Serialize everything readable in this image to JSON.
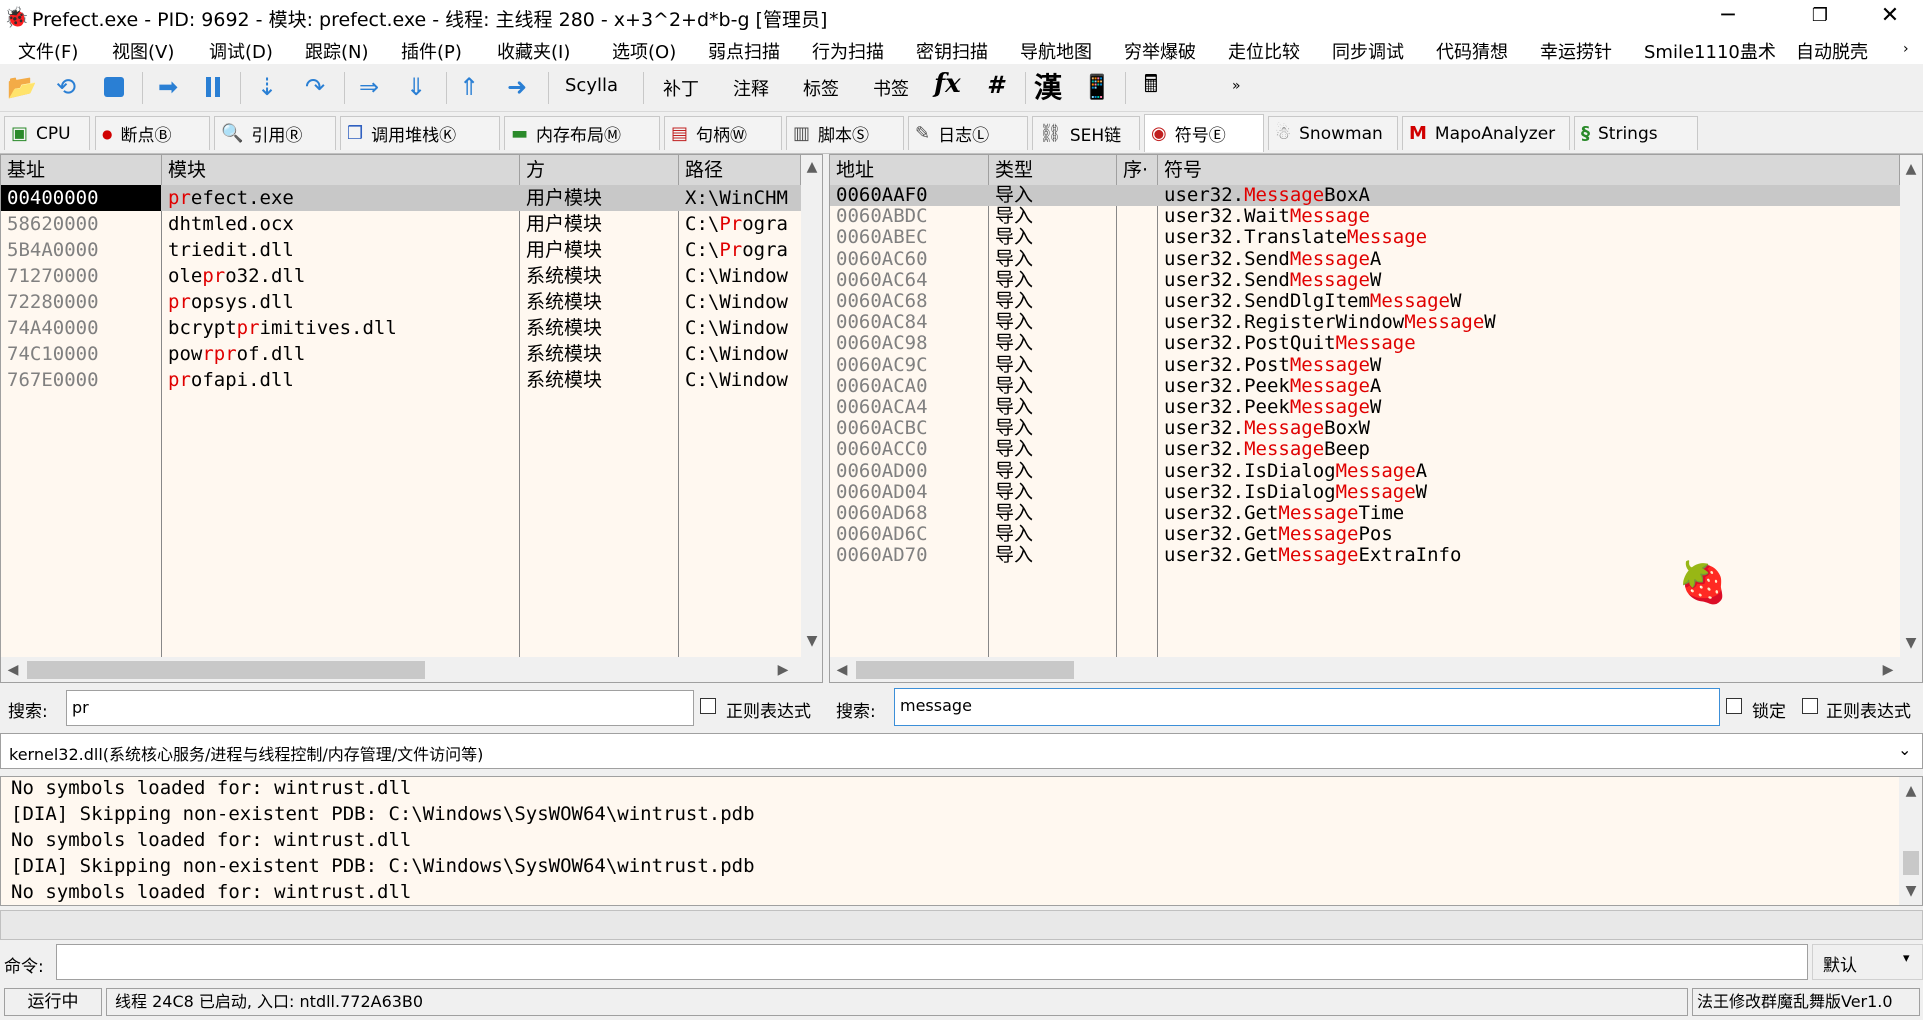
{
  "window": {
    "title": "Prefect.exe - PID: 9692 - 模块: prefect.exe - 线程: 主线程 280 - x+3^2+d*b-g [管理员]",
    "minimize": "─",
    "maximize": "❐",
    "close": "✕"
  },
  "menu": [
    "文件(F)",
    "视图(V)",
    "调试(D)",
    "跟踪(N)",
    "插件(P)",
    "收藏夹(I)",
    "选项(O)",
    "弱点扫描",
    "行为扫描",
    "密钥扫描",
    "导航地图",
    "穷举爆破",
    "走位比较",
    "同步调试",
    "代码猜想",
    "幸运捞针",
    "Smile1110蛊术",
    "自动脱壳"
  ],
  "menu_scroll_icon": "chevron-right-icon",
  "toolbar": {
    "text_buttons": [
      "Scylla",
      "补丁",
      "注释",
      "标签",
      "书签"
    ],
    "fx_label": "fx",
    "hash_label": "#",
    "han_label": "漢",
    "more_label": "»"
  },
  "tabs": [
    {
      "label": "CPU",
      "icon": "cpu-icon"
    },
    {
      "label": "断点Ⓑ",
      "icon": "breakpoint-icon"
    },
    {
      "label": "引用Ⓡ",
      "icon": "magnifier-icon"
    },
    {
      "label": "调用堆栈Ⓚ",
      "icon": "stack-icon"
    },
    {
      "label": "内存布局Ⓜ",
      "icon": "memory-icon"
    },
    {
      "label": "句柄Ⓦ",
      "icon": "handle-icon"
    },
    {
      "label": "脚本Ⓢ",
      "icon": "script-icon"
    },
    {
      "label": "日志Ⓛ",
      "icon": "log-icon"
    },
    {
      "label": "SEH链",
      "icon": "seh-icon"
    },
    {
      "label": "符号Ⓔ",
      "icon": "symbol-icon"
    },
    {
      "label": "Snowman",
      "icon": "snowman-icon"
    },
    {
      "label": "MapoAnalyzer",
      "icon": "mapo-icon"
    },
    {
      "label": "Strings",
      "icon": "strings-icon"
    }
  ],
  "modules": {
    "headers": [
      "基址",
      "模块",
      "方",
      "路径"
    ],
    "rows": [
      {
        "base": "00400000",
        "pre": "",
        "hl": "pr",
        "post": "efect.exe",
        "type": "用户模块",
        "path_pre": "X:\\WinCHM",
        "path_hl": "",
        "path_post": "",
        "selected": true
      },
      {
        "base": "58620000",
        "pre": "dhtmled.ocx",
        "hl": "",
        "post": "",
        "type": "用户模块",
        "path_pre": "C:\\",
        "path_hl": "Pr",
        "path_post": "ogra"
      },
      {
        "base": "5B4A0000",
        "pre": "triedit.dll",
        "hl": "",
        "post": "",
        "type": "用户模块",
        "path_pre": "C:\\",
        "path_hl": "Pr",
        "path_post": "ogra"
      },
      {
        "base": "71270000",
        "pre": "ole",
        "hl": "pr",
        "post": "o32.dll",
        "type": "系统模块",
        "path_pre": "C:\\Window",
        "path_hl": "",
        "path_post": ""
      },
      {
        "base": "72280000",
        "pre": "",
        "hl": "pr",
        "post": "opsys.dll",
        "type": "系统模块",
        "path_pre": "C:\\Window",
        "path_hl": "",
        "path_post": ""
      },
      {
        "base": "74A40000",
        "pre": "bcrypt",
        "hl": "pr",
        "post": "imitives.dll",
        "type": "系统模块",
        "path_pre": "C:\\Window",
        "path_hl": "",
        "path_post": ""
      },
      {
        "base": "74C10000",
        "pre": "pow",
        "hl": "rpr",
        "post": "of.dll",
        "type": "系统模块",
        "path_pre": "C:\\Window",
        "path_hl": "",
        "path_post": ""
      },
      {
        "base": "767E0000",
        "pre": "",
        "hl": "pr",
        "post": "ofapi.dll",
        "type": "系统模块",
        "path_pre": "C:\\Window",
        "path_hl": "",
        "path_post": ""
      }
    ]
  },
  "symbols": {
    "headers": [
      "地址",
      "类型",
      "序·",
      "符号"
    ],
    "rows": [
      {
        "addr": "0060AAF0",
        "type": "导入",
        "pre": "user32.",
        "hl": "Message",
        "post": "BoxA",
        "selected": true
      },
      {
        "addr": "0060ABDC",
        "type": "导入",
        "pre": "user32.Wait",
        "hl": "Message",
        "post": ""
      },
      {
        "addr": "0060ABEC",
        "type": "导入",
        "pre": "user32.Translate",
        "hl": "Message",
        "post": ""
      },
      {
        "addr": "0060AC60",
        "type": "导入",
        "pre": "user32.Send",
        "hl": "Message",
        "post": "A"
      },
      {
        "addr": "0060AC64",
        "type": "导入",
        "pre": "user32.Send",
        "hl": "Message",
        "post": "W"
      },
      {
        "addr": "0060AC68",
        "type": "导入",
        "pre": "user32.SendDlgItem",
        "hl": "Message",
        "post": "W"
      },
      {
        "addr": "0060AC84",
        "type": "导入",
        "pre": "user32.RegisterWindow",
        "hl": "Message",
        "post": "W"
      },
      {
        "addr": "0060AC98",
        "type": "导入",
        "pre": "user32.PostQuit",
        "hl": "Message",
        "post": ""
      },
      {
        "addr": "0060AC9C",
        "type": "导入",
        "pre": "user32.Post",
        "hl": "Message",
        "post": "W"
      },
      {
        "addr": "0060ACA0",
        "type": "导入",
        "pre": "user32.Peek",
        "hl": "Message",
        "post": "A"
      },
      {
        "addr": "0060ACA4",
        "type": "导入",
        "pre": "user32.Peek",
        "hl": "Message",
        "post": "W"
      },
      {
        "addr": "0060ACBC",
        "type": "导入",
        "pre": "user32.",
        "hl": "Message",
        "post": "BoxW"
      },
      {
        "addr": "0060ACC0",
        "type": "导入",
        "pre": "user32.",
        "hl": "Message",
        "post": "Beep"
      },
      {
        "addr": "0060AD00",
        "type": "导入",
        "pre": "user32.IsDialog",
        "hl": "Message",
        "post": "A"
      },
      {
        "addr": "0060AD04",
        "type": "导入",
        "pre": "user32.IsDialog",
        "hl": "Message",
        "post": "W"
      },
      {
        "addr": "0060AD68",
        "type": "导入",
        "pre": "user32.Get",
        "hl": "Message",
        "post": "Time"
      },
      {
        "addr": "0060AD6C",
        "type": "导入",
        "pre": "user32.Get",
        "hl": "Message",
        "post": "Pos"
      },
      {
        "addr": "0060AD70",
        "type": "导入",
        "pre": "user32.Get",
        "hl": "Message",
        "post": "ExtraInfo"
      }
    ]
  },
  "search_left": {
    "label": "搜索:",
    "value": "pr",
    "regex_label": "正则表达式"
  },
  "search_right": {
    "label": "搜索:",
    "value": "message",
    "lock_label": "锁定",
    "regex_label": "正则表达式"
  },
  "module_combo": {
    "value": "kernel32.dll(系统核心服务/进程与线程控制/内存管理/文件访问等)"
  },
  "log_lines": [
    "No symbols loaded for: wintrust.dll",
    "[DIA] Skipping non-existent PDB: C:\\Windows\\SysWOW64\\wintrust.pdb",
    "No symbols loaded for: wintrust.dll",
    "[DIA] Skipping non-existent PDB: C:\\Windows\\SysWOW64\\wintrust.pdb",
    "No symbols loaded for: wintrust.dll"
  ],
  "command": {
    "label": "命令:",
    "value": "",
    "mode": "默认"
  },
  "status": {
    "state": "运行中",
    "message": "线程 24C8 已启动, 入口: ntdll.772A63B0",
    "version": "法王修改群魔乱舞版Ver1.0"
  },
  "colors": {
    "highlight": "#e00000",
    "selection": "#c8c8c8",
    "panel_bg": "#fff8f0",
    "status_running": "#000000"
  }
}
